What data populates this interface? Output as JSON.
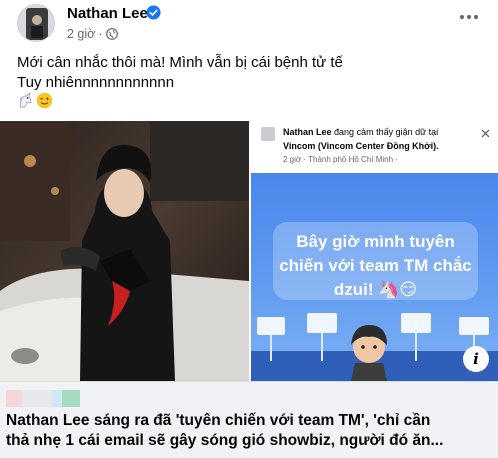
{
  "post": {
    "author": "Nathan Lee",
    "time": "2 giờ",
    "separator": "·",
    "text_line1": "Mới cân nhắc thôi mà! Mình vẫn bị cái bệnh tử tế",
    "text_line2": "Tuy nhiênnnnnnnnnnnn",
    "emoji_unicorn": "🦄",
    "emoji_smile": "😉"
  },
  "screenshot": {
    "name": "Nathan Lee",
    "status": "đang",
    "feeling": "cảm thấy giận dữ tại",
    "place": "Vincom (Vincom Center Đồng Khởi).",
    "location": "2 giờ · Thành phố Hồ Chí Minh ·",
    "caption": "Bây giờ mình tuyên chiến với team TM chắc dzui!",
    "caption_emojis": "🦄😏"
  },
  "link": {
    "title_line1": "Nathan Lee sáng ra đã 'tuyên chiến với team TM', 'chỉ cần",
    "title_line2": "thả nhẹ 1 cái email sẽ gây sóng gió showbiz, người đó ăn...",
    "info_label": "i"
  },
  "colors": {
    "verified": "#1877f2",
    "secondary_text": "#65676b",
    "preview_bg": "#f0f2f5",
    "screenshot_bg": "#4a88ec"
  },
  "icons": {
    "verified": "verified-badge-icon",
    "audience": "globe-icon",
    "more": "more-options-icon",
    "info": "info-icon"
  }
}
